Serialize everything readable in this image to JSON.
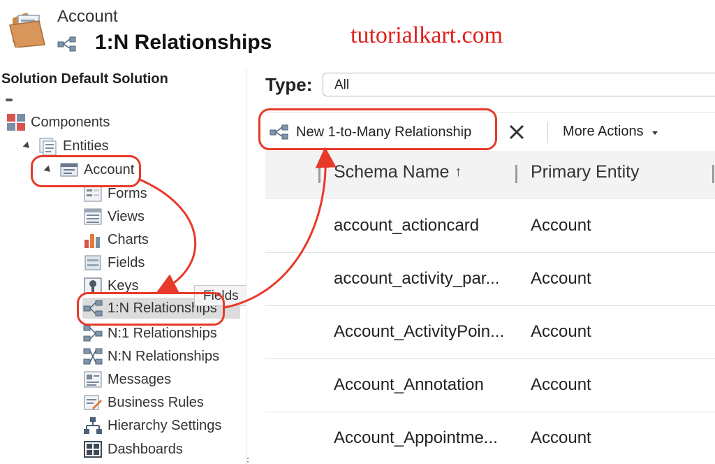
{
  "header": {
    "entity_name": "Account",
    "page_title": "1:N Relationships"
  },
  "watermark": "tutorialkart.com",
  "sidebar": {
    "solution_title": "Solution Default Solution",
    "components_label": "Components",
    "entities_label": "Entities",
    "account_label": "Account",
    "items": [
      {
        "label": "Forms",
        "icon": "form-icon"
      },
      {
        "label": "Views",
        "icon": "view-icon"
      },
      {
        "label": "Charts",
        "icon": "chart-icon"
      },
      {
        "label": "Fields",
        "icon": "field-icon"
      },
      {
        "label": "Keys",
        "icon": "key-icon"
      },
      {
        "label": "1:N Relationships",
        "icon": "relationship-1n-icon"
      },
      {
        "label": "N:1 Relationships",
        "icon": "relationship-n1-icon"
      },
      {
        "label": "N:N Relationships",
        "icon": "relationship-nn-icon"
      },
      {
        "label": "Messages",
        "icon": "message-icon"
      },
      {
        "label": "Business Rules",
        "icon": "business-rule-icon"
      },
      {
        "label": "Hierarchy Settings",
        "icon": "hierarchy-icon"
      },
      {
        "label": "Dashboards",
        "icon": "dashboard-icon"
      }
    ],
    "tooltip": "Fields"
  },
  "filter": {
    "type_label": "Type:",
    "type_value": "All"
  },
  "toolbar": {
    "new_label": "New 1-to-Many Relationship",
    "more_actions_label": "More Actions"
  },
  "grid": {
    "columns": [
      "Schema Name",
      "Primary Entity"
    ],
    "sort_indicator": "↑",
    "rows": [
      {
        "schema_name": "account_actioncard",
        "primary_entity": "Account"
      },
      {
        "schema_name": "account_activity_par...",
        "primary_entity": "Account"
      },
      {
        "schema_name": "Account_ActivityPoin...",
        "primary_entity": "Account"
      },
      {
        "schema_name": "Account_Annotation",
        "primary_entity": "Account"
      },
      {
        "schema_name": "Account_Appointme...",
        "primary_entity": "Account"
      }
    ]
  },
  "colors": {
    "annotation": "#e8392a",
    "watermark": "#e0201c",
    "selected_row": "#dcdcdc",
    "grid_header": "#f3f3f3"
  }
}
